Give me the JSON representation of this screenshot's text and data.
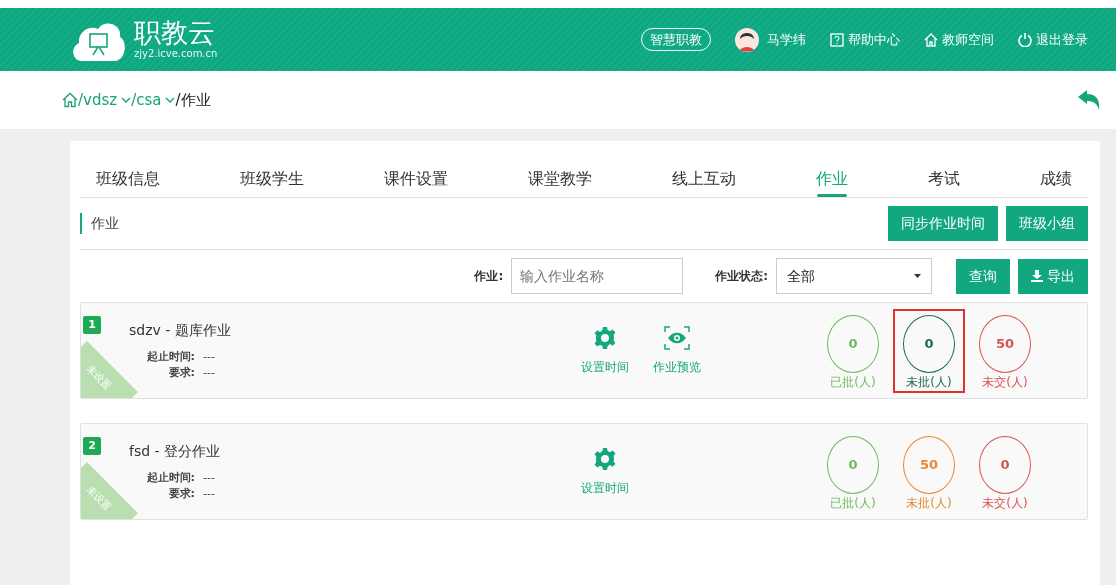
{
  "header": {
    "logo_title": "职教云",
    "logo_url": "zjy2.icve.com.cn",
    "nav": [
      {
        "kind": "pill",
        "label": "智慧职教"
      },
      {
        "kind": "user",
        "label": "马学纬"
      },
      {
        "kind": "help",
        "label": "帮助中心"
      },
      {
        "kind": "home",
        "label": "教师空间"
      },
      {
        "kind": "power",
        "label": "退出登录"
      }
    ]
  },
  "breadcrumb": [
    {
      "label": "/vdsz",
      "dropdown": true
    },
    {
      "label": "/csa",
      "dropdown": true
    },
    {
      "label": "/作业",
      "dropdown": false
    }
  ],
  "tabs": [
    {
      "label": "班级信息",
      "selected": false
    },
    {
      "label": "班级学生",
      "selected": false
    },
    {
      "label": "课件设置",
      "selected": false
    },
    {
      "label": "课堂教学",
      "selected": false
    },
    {
      "label": "线上互动",
      "selected": false
    },
    {
      "label": "作业",
      "selected": true
    },
    {
      "label": "考试",
      "selected": false
    },
    {
      "label": "成绩",
      "selected": false
    }
  ],
  "section_title": "作业",
  "section_buttons": [
    "同步作业时间",
    "班级小组"
  ],
  "filter": {
    "name_label": "作业:",
    "name_placeholder": "输入作业名称",
    "status_label": "作业状态:",
    "status_value": "全部",
    "query_button": "查询",
    "export_button": "导出"
  },
  "assignments": [
    {
      "index": "1",
      "title": "sdzv - 题库作业",
      "ribbon": "未设置",
      "time_label": "起止时间:",
      "time_value": "---",
      "req_label": "要求:",
      "req_value": "---",
      "actions": [
        {
          "kind": "gear",
          "label": "设置时间"
        },
        {
          "kind": "preview",
          "label": "作业预览"
        }
      ],
      "stats": [
        {
          "value": "0",
          "label": "已批(人)",
          "color": "#6dbb5e",
          "highlighted": false
        },
        {
          "value": "0",
          "label": "未批(人)",
          "color": "#1d6b55",
          "highlighted": true
        },
        {
          "value": "50",
          "label": "未交(人)",
          "color": "#d9534f",
          "highlighted": false
        }
      ]
    },
    {
      "index": "2",
      "title": "fsd - 登分作业",
      "ribbon": "未设置",
      "time_label": "起止时间:",
      "time_value": "---",
      "req_label": "要求:",
      "req_value": "---",
      "actions": [
        {
          "kind": "gear",
          "label": "设置时间"
        }
      ],
      "stats": [
        {
          "value": "0",
          "label": "已批(人)",
          "color": "#6dbb5e",
          "highlighted": false
        },
        {
          "value": "50",
          "label": "未批(人)",
          "color": "#e8892f",
          "highlighted": false
        },
        {
          "value": "0",
          "label": "未交(人)",
          "color": "#d9534f",
          "highlighted": false
        }
      ]
    }
  ]
}
